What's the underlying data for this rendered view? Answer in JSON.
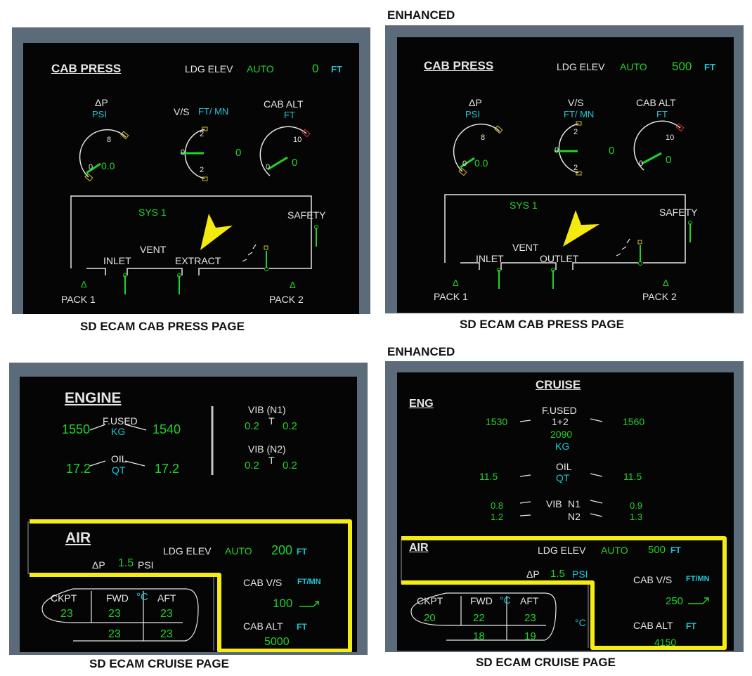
{
  "labels": {
    "enhanced": "ENHANCED",
    "cab_press_page": "SD ECAM CAB PRESS PAGE",
    "cruise_page": "SD ECAM CRUISE PAGE"
  },
  "cab_press": {
    "title": "CAB PRESS",
    "ldg_elev": "LDG ELEV",
    "auto": "AUTO",
    "ft": "FT",
    "delta_p": "ΔP",
    "psi": "PSI",
    "vs": "V/S",
    "ft_mn": "FT/ MN",
    "cab_alt": "CAB ALT",
    "dp_tick": "8",
    "dp_zero": "0",
    "dp_value": "0.0",
    "vs_top": "2",
    "vs_zero": "0",
    "vs_bottom": "2",
    "vs_value": "0",
    "alt_tick": "10",
    "alt_zero": "0",
    "alt_value": "0",
    "sys": "SYS 1",
    "safety": "SAFETY",
    "vent": "VENT",
    "inlet": "INLET",
    "pack1": "PACK 1",
    "pack2": "PACK 2",
    "triangle": "Δ",
    "left": {
      "ldg_value": "0",
      "extract": "EXTRACT"
    },
    "right": {
      "ldg_value": "500",
      "outlet": "OUTLET"
    }
  },
  "engine_page": {
    "title": "ENGINE",
    "fused": "F.USED",
    "kg": "KG",
    "fused_left": "1550",
    "fused_right": "1540",
    "oil": "OIL",
    "qt": "QT",
    "oil_left": "17.2",
    "oil_right": "17.2",
    "vib_n1": "VIB (N1)",
    "vib_n1_left": "0.2",
    "vib_n1_right": "0.2",
    "vib_n2": "VIB (N2)",
    "vib_n2_left": "0.2",
    "vib_n2_right": "0.2",
    "t_mark": "T"
  },
  "cruise_page": {
    "title": "CRUISE",
    "eng": "ENG",
    "fused": "F.USED",
    "one_plus_two": "1+2",
    "fused_total": "2090",
    "kg": "KG",
    "fused_left": "1530",
    "fused_right": "1560",
    "oil": "OIL",
    "qt": "QT",
    "oil_left": "11.5",
    "oil_right": "11.5",
    "vib": "VIB",
    "n1": "N1",
    "n2": "N2",
    "vib_n1_left": "0.8",
    "vib_n1_right": "0.9",
    "vib_n2_left": "1.2",
    "vib_n2_right": "1.3"
  },
  "air": {
    "title": "AIR",
    "ldg_elev": "LDG ELEV",
    "auto": "AUTO",
    "ft": "FT",
    "delta_p": "ΔP",
    "psi": "PSI",
    "cab_vs": "CAB V/S",
    "ft_mn": "FT/MN",
    "cab_alt": "CAB ALT",
    "ckpt": "CKPT",
    "fwd": "FWD",
    "deg_c": "°C",
    "aft": "AFT",
    "left": {
      "ldg_value": "200",
      "dp_value": "1.5",
      "vs_value": "100",
      "alt_value": "5000",
      "ckpt_temp": "23",
      "fwd_temp": "23",
      "aft_temp": "23",
      "fwd_duct": "23",
      "aft_duct": "23"
    },
    "right": {
      "ldg_value": "500",
      "dp_value": "1.5",
      "vs_value": "250",
      "alt_value": "4150",
      "ckpt_temp": "20",
      "fwd_temp": "22",
      "aft_temp": "23",
      "fwd_duct": "18",
      "aft_duct": "19"
    }
  }
}
